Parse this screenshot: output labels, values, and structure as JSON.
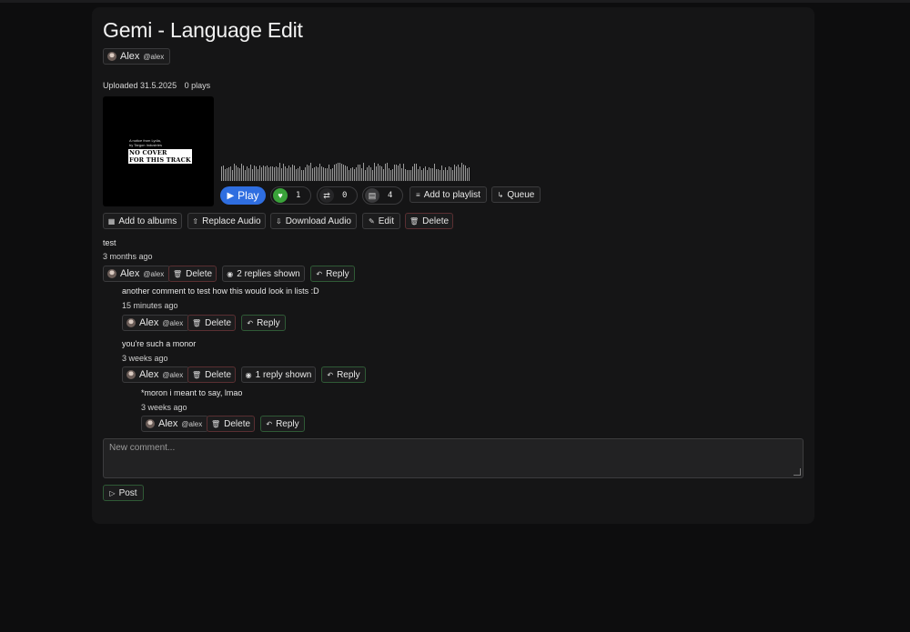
{
  "page": {
    "title": "Gemi - Language Edit"
  },
  "author": {
    "name": "Alex",
    "handle": "@alex"
  },
  "meta": {
    "uploaded": "Uploaded 31.5.2025",
    "plays": "0 plays"
  },
  "cover": {
    "line1": "A notice from Lydia,",
    "line2": "by Targon Industries",
    "line3": "NO COVER",
    "line4": "FOR THIS TRACK"
  },
  "player": {
    "play_label": "Play",
    "likes": "1",
    "reposts": "0",
    "comments": "4",
    "add_playlist": "Add to playlist",
    "queue": "Queue"
  },
  "actions": {
    "add_albums": "Add to albums",
    "replace_audio": "Replace Audio",
    "download_audio": "Download Audio",
    "edit": "Edit",
    "delete": "Delete"
  },
  "comments": [
    {
      "text": "test",
      "time": "3 months ago",
      "author": "Alex",
      "handle": "@alex",
      "delete": "Delete",
      "replies": "2 replies shown",
      "reply": "Reply"
    },
    {
      "text": "another comment to test how this would look in lists :D",
      "time": "15 minutes ago",
      "author": "Alex",
      "handle": "@alex",
      "delete": "Delete",
      "reply": "Reply"
    },
    {
      "text": "you're such a monor",
      "time": "3 weeks ago",
      "author": "Alex",
      "handle": "@alex",
      "delete": "Delete",
      "replies": "1 reply shown",
      "reply": "Reply"
    },
    {
      "text": "*moron i meant to say, lmao",
      "time": "3 weeks ago",
      "author": "Alex",
      "handle": "@alex",
      "delete": "Delete",
      "reply": "Reply"
    }
  ],
  "new_comment": {
    "placeholder": "New comment...",
    "post": "Post"
  },
  "colors": {
    "accent": "#2f6ee0",
    "like": "#3aa33a",
    "background": "#0d0d0e",
    "card": "#151516"
  },
  "icons": [
    "play-icon",
    "heart-icon",
    "repost-icon",
    "comment-icon",
    "playlist-icon",
    "queue-icon",
    "album-icon",
    "upload-icon",
    "download-icon",
    "pencil-icon",
    "trash-icon",
    "eye-icon",
    "reply-icon",
    "send-icon"
  ]
}
